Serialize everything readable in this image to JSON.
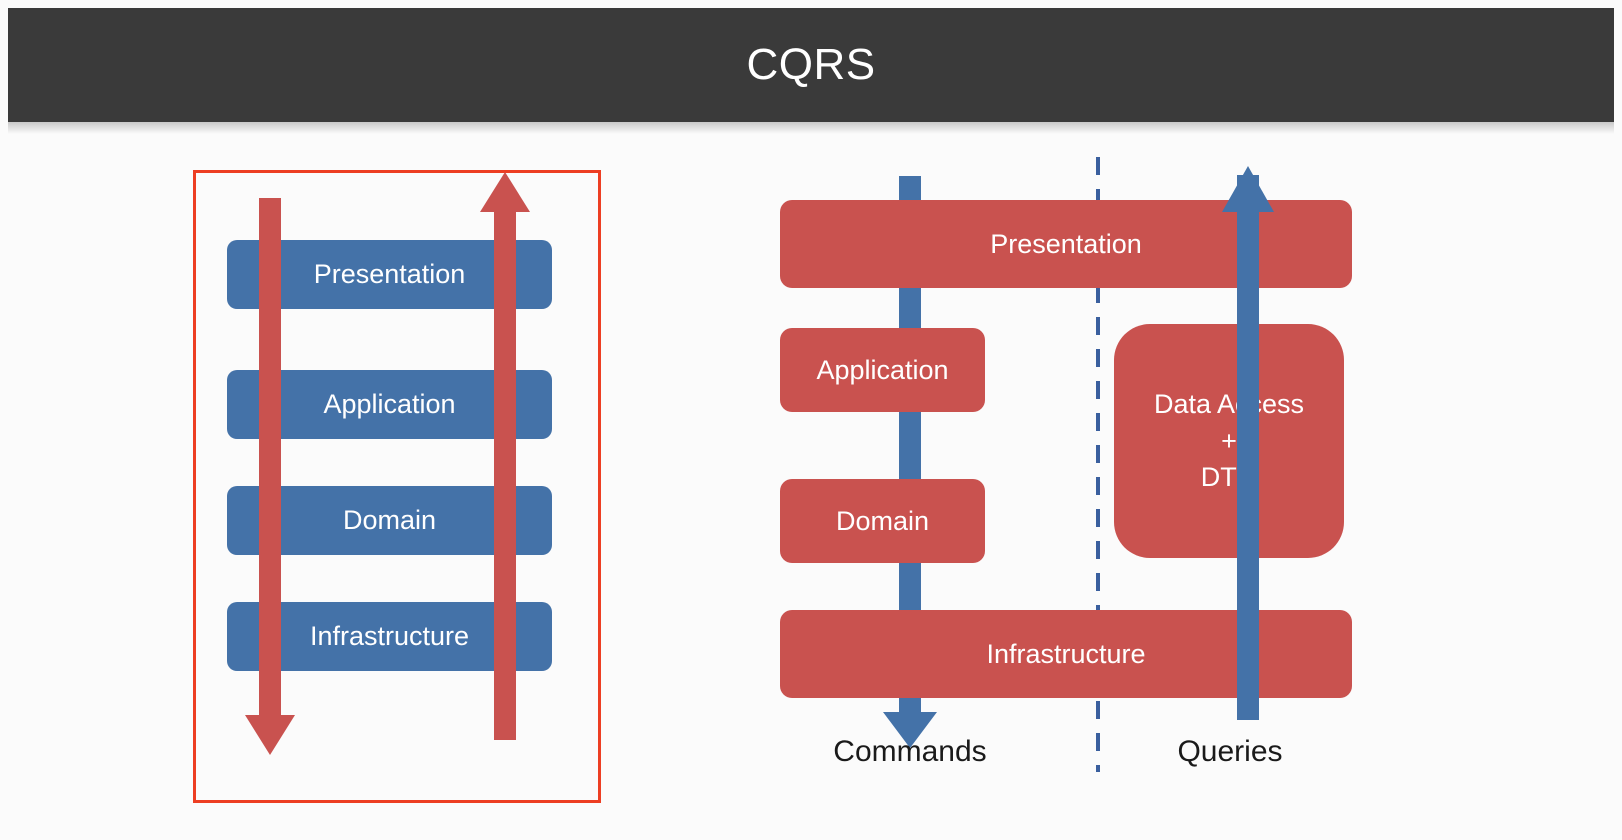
{
  "header": {
    "title": "CQRS",
    "bg_color": "#3a3a3a",
    "text_color": "#ffffff"
  },
  "colors": {
    "blue_box": "#4472a8",
    "red_box": "#c9524f",
    "red_arrow": "#c9524f",
    "blue_arrow": "#4472a8",
    "red_border": "#ed3e23",
    "background": "#fbfbfb",
    "label_text": "#1a1a1a"
  },
  "left_diagram": {
    "name": "layered-architecture",
    "border_color": "#ed3e23",
    "layers": [
      {
        "label": "Presentation"
      },
      {
        "label": "Application"
      },
      {
        "label": "Domain"
      },
      {
        "label": "Infrastructure"
      }
    ],
    "arrows": [
      {
        "name": "downward-flow-arrow",
        "direction": "down",
        "color": "#c9524f"
      },
      {
        "name": "upward-flow-arrow",
        "direction": "up",
        "color": "#c9524f"
      }
    ]
  },
  "right_diagram": {
    "name": "cqrs-split-architecture",
    "boxes": [
      {
        "id": "presentation",
        "label": "Presentation"
      },
      {
        "id": "application",
        "label": "Application"
      },
      {
        "id": "domain",
        "label": "Domain"
      },
      {
        "id": "infrastructure",
        "label": "Infrastructure"
      },
      {
        "id": "dataaccess",
        "label_line1": "Data Access",
        "label_line2": "+",
        "label_line3": "DTO"
      }
    ],
    "flows": [
      {
        "id": "commands",
        "label": "Commands",
        "direction": "down",
        "color": "#4472a8"
      },
      {
        "id": "queries",
        "label": "Queries",
        "direction": "up",
        "color": "#4472a8"
      }
    ],
    "divider": {
      "name": "command-query-separator",
      "style": "dashed",
      "color": "#3a5f9e"
    }
  }
}
